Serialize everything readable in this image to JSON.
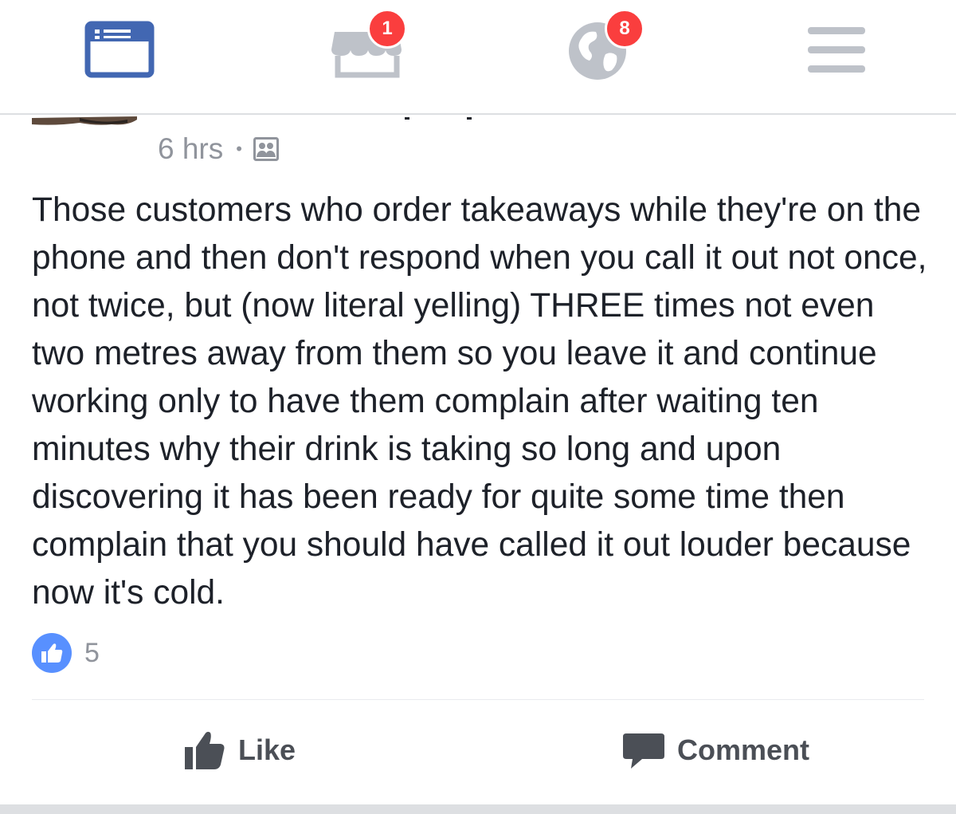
{
  "navbar": {
    "tabs": [
      {
        "name": "news-feed",
        "icon": "news-feed-icon",
        "active": true
      },
      {
        "name": "marketplace",
        "icon": "marketplace-icon",
        "badge": "1"
      },
      {
        "name": "notifications",
        "icon": "globe-icon",
        "badge": "8"
      },
      {
        "name": "menu",
        "icon": "hamburger-menu-icon"
      }
    ]
  },
  "post": {
    "time": "6 hrs",
    "separator": "•",
    "privacy_icon": "friends-privacy-icon",
    "text": "Those customers who order takeaways while they're on the phone and then don't respond when you call it out not once, not twice, but (now literal yelling) THREE times not even two metres away from them so you leave it and continue working only to have them complain after waiting ten minutes why their drink is taking so long and upon discovering it has been ready for quite some time then complain that you should have called it out louder because now it's cold.",
    "reactions": {
      "icon": "like-reaction-icon",
      "count": "5"
    }
  },
  "actions": {
    "like_label": "Like",
    "comment_label": "Comment"
  },
  "colors": {
    "brand_blue": "#4267b2",
    "badge_red": "#fa3e3e",
    "like_blue": "#5890ff",
    "icon_gray": "#bec2c9",
    "text_primary": "#1d2129",
    "text_secondary": "#90949c",
    "action_text": "#4b4f56"
  }
}
